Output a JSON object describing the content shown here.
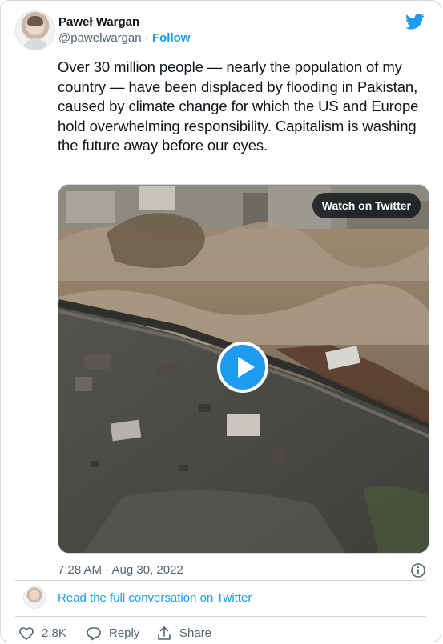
{
  "author": {
    "display_name": "Paweł Wargan",
    "handle": "@pawelwargan",
    "separator": "·",
    "follow_label": "Follow"
  },
  "tweet": {
    "text": "Over 30 million people — nearly the population of my country — have been displaced by flooding in Pakistan, caused by climate change for which the US and Europe hold overwhelming responsibility. Capitalism is washing the future away before our eyes."
  },
  "media": {
    "watch_label": "Watch on Twitter"
  },
  "meta": {
    "timestamp": "7:28 AM · Aug 30, 2022"
  },
  "conversation": {
    "link_label": "Read the full conversation on Twitter"
  },
  "actions": {
    "likes": "2.8K",
    "reply_label": "Reply",
    "share_label": "Share"
  },
  "colors": {
    "brand": "#1d9bf0",
    "text": "#0f1419",
    "secondary": "#536471"
  }
}
